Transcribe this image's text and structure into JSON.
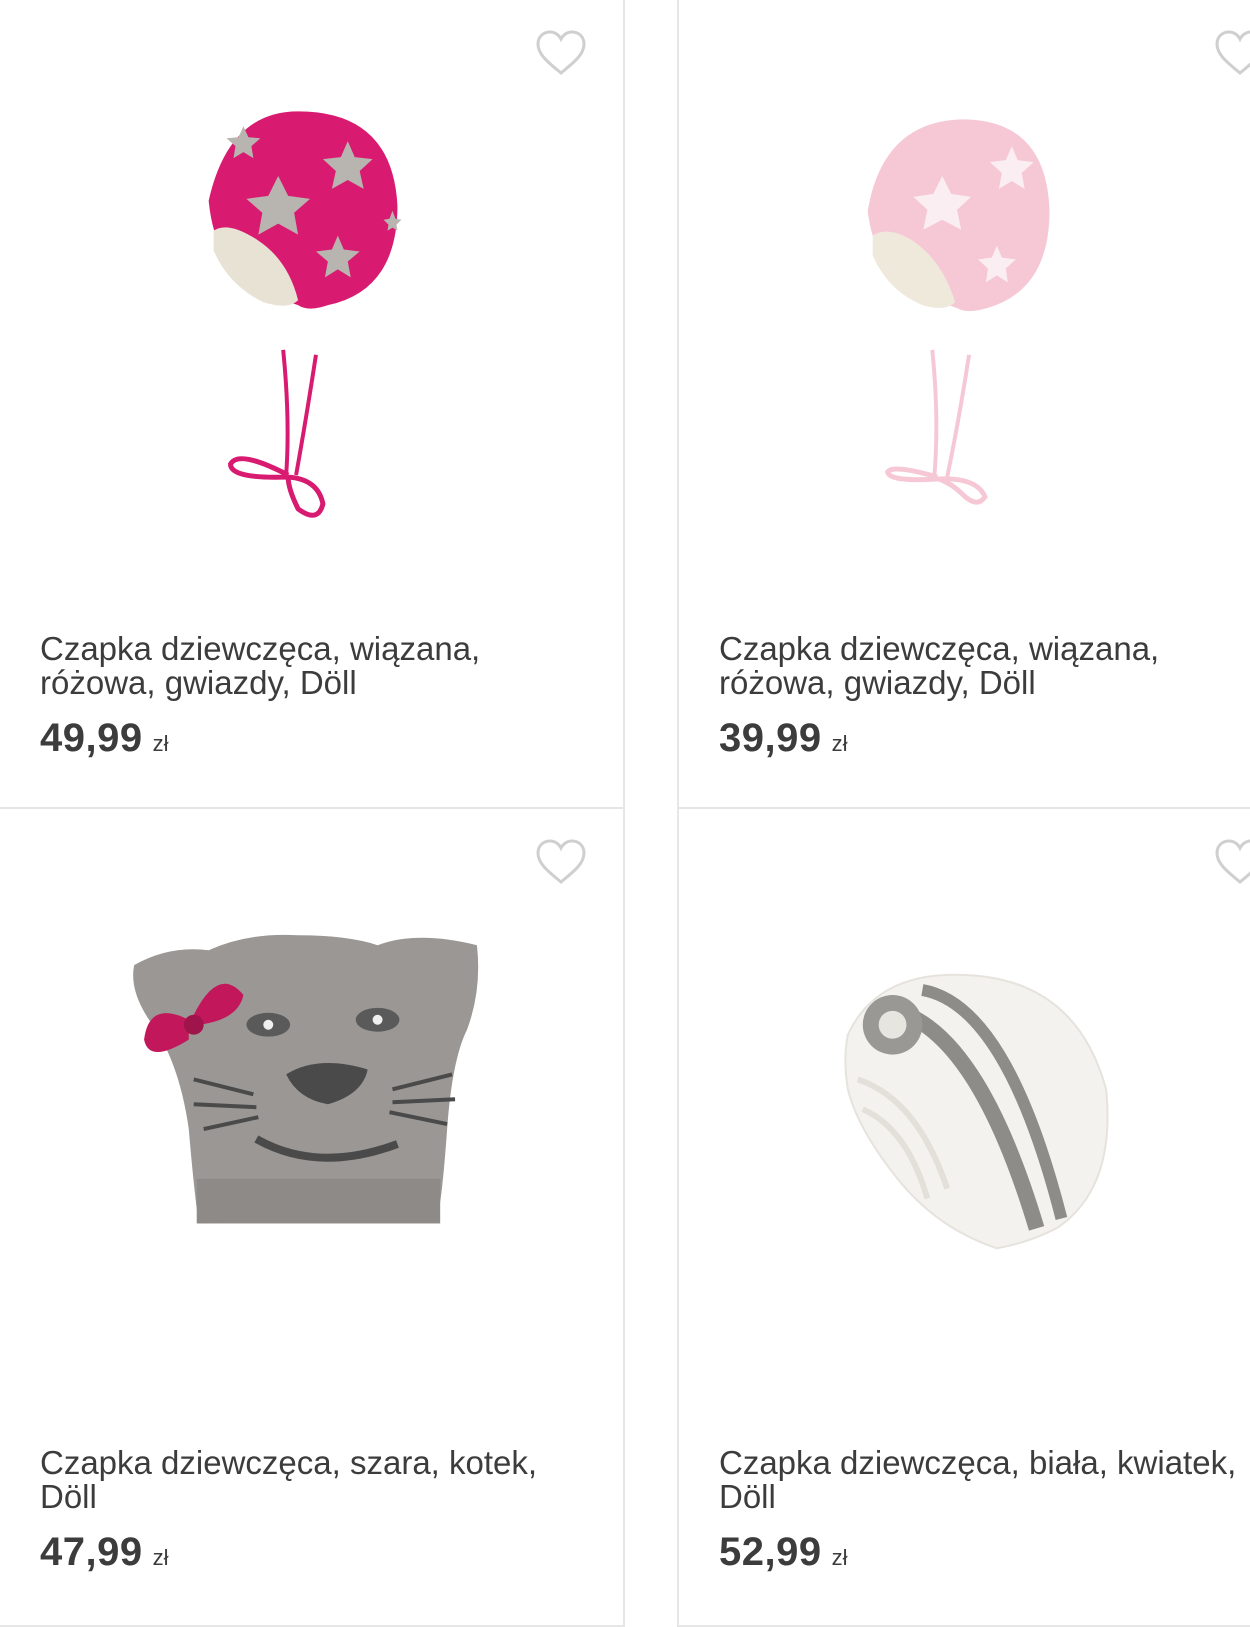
{
  "products": [
    {
      "title": "Czapka dziewczęca, wiązana, różowa, gwiazdy, Döll",
      "price": "49,99",
      "currency": "zł",
      "image": "hat-pink-stars-icon",
      "colors": {
        "main": "#d81b70",
        "star": "#b8b5b0",
        "lining": "#e8e2d4"
      }
    },
    {
      "title": "Czapka dziewczęca, wiązana, różowa, gwiazdy, Döll",
      "price": "39,99",
      "currency": "zł",
      "image": "hat-light-pink-stars-icon",
      "colors": {
        "main": "#f6c8d6",
        "star": "#fbeef2",
        "lining": "#efe9dc"
      }
    },
    {
      "title": "Czapka dziewczęca, szara, kotek, Döll",
      "price": "47,99",
      "currency": "zł",
      "image": "hat-grey-cat-icon",
      "colors": {
        "main": "#9a9794",
        "accent": "#c2185b",
        "dark": "#4a4a4a"
      }
    },
    {
      "title": "Czapka dziewczęca, biała, kwiatek, Döll",
      "price": "52,99",
      "currency": "zł",
      "image": "hat-white-flower-icon",
      "colors": {
        "main": "#f4f2ee",
        "stripe": "#8e8c88"
      }
    }
  ],
  "theme": {
    "border": "#e6e6e6",
    "heart_outline": "#cfcfcf",
    "text": "#3c3c3c"
  }
}
